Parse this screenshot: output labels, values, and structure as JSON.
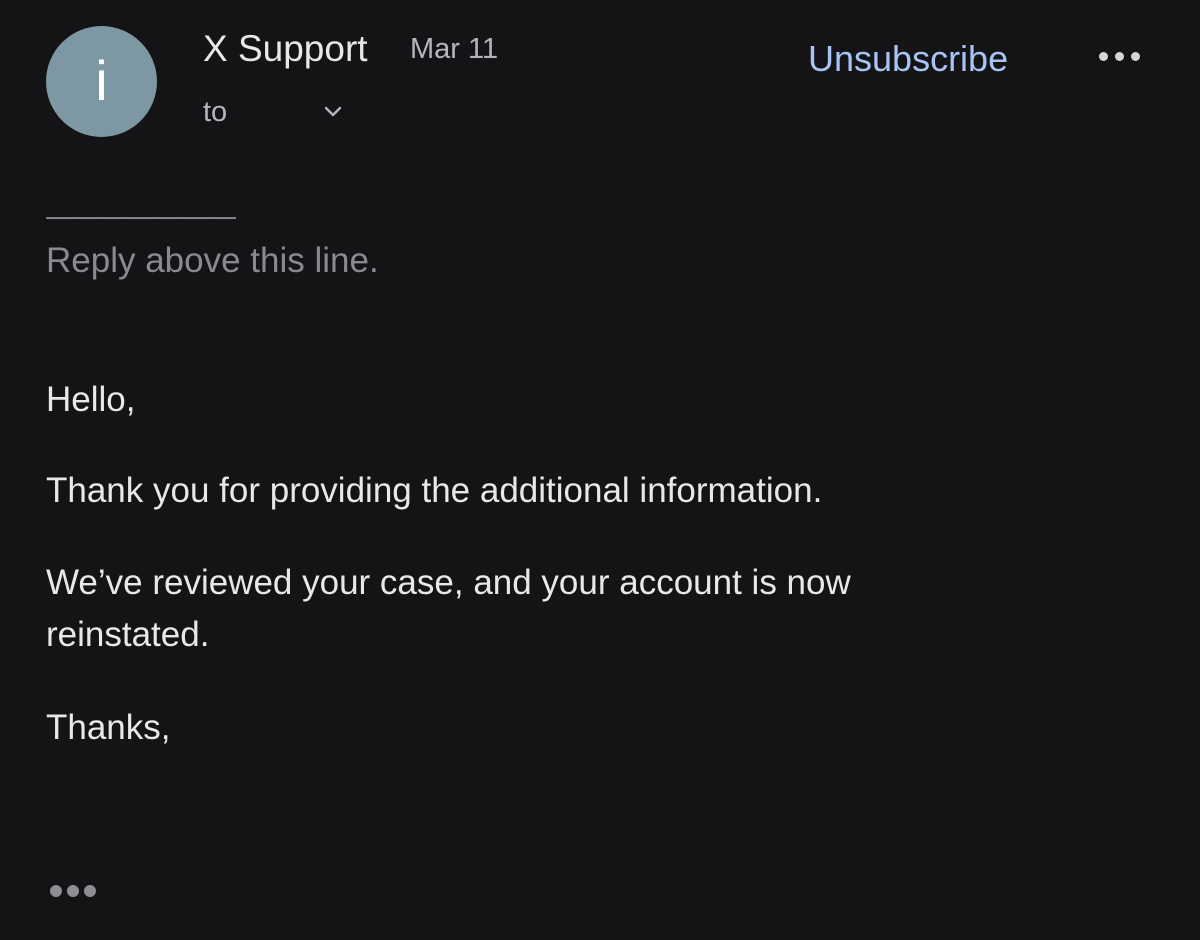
{
  "header": {
    "avatar_letter": "i",
    "avatar_color": "#7d97a3",
    "sender": "X Support",
    "date": "Mar 11",
    "to_label": "to",
    "chevron_icon": "chevron-down-icon",
    "unsubscribe_label": "Unsubscribe",
    "unsubscribe_color": "#a8c4f5",
    "more_icon": "more-horizontal-icon"
  },
  "message": {
    "separator": "———————",
    "reply_hint": "Reply above this line.",
    "paragraphs": [
      "Hello,",
      "Thank you for providing the additional information.",
      "We’ve reviewed your case, and your account is now reinstated.",
      "Thanks,"
    ]
  },
  "footer": {
    "show_trimmed_icon": "ellipsis-icon"
  },
  "colors": {
    "background": "#141416",
    "text": "#e8e8ea",
    "muted": "#8a8a8e"
  }
}
